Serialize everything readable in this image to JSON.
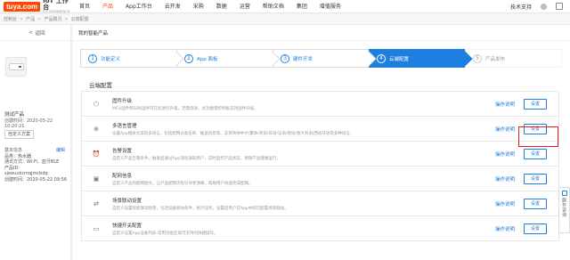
{
  "header": {
    "logo_badge": "tuya.com",
    "logo_title": "IoT 工作台",
    "logo_sub": "IOT WORKBENCH",
    "nav": [
      "首页",
      "产品",
      "App工作台",
      "云开发",
      "采购",
      "数据",
      "运营",
      "帮助文档",
      "集团",
      "增值服务"
    ],
    "active_nav": "产品",
    "support": "技术支持",
    "accent": "#ff4800"
  },
  "breadcrumb": [
    "控制台",
    "产品",
    "产品概况",
    "云端配置"
  ],
  "sidebar": {
    "back": "返回",
    "product_name": "测试产品",
    "created": "创建时间：2020-05-22 10:20:21",
    "custom_button": "自定义方案",
    "info_title": "基本信息",
    "edit": "编辑",
    "info": [
      "品类：热水器",
      "通讯方式：Wi-Fi、蓝牙BLE",
      "产品ID:",
      "sjeeuukcmqjmcbdq",
      "创建时间：2020-05-22 09:56"
    ]
  },
  "main": {
    "title": "我的智能产品",
    "steps": [
      {
        "num": "1",
        "label": "功能定义"
      },
      {
        "num": "2",
        "label": "App 面板"
      },
      {
        "num": "3",
        "label": "硬件开发"
      },
      {
        "num": "4",
        "label": "云端配置"
      },
      {
        "num": "5",
        "label": "产品发布"
      }
    ],
    "active_step": 3,
    "section_title": "云端配置",
    "rows": [
      {
        "icon": "firmware-icon",
        "glyph": "⬡",
        "title": "固件升级",
        "desc": "MCU固件和SDK固件可在此进行升级，无需烧录。此功能需控制板支持固件升级。",
        "doc": "操作说明",
        "btn": "设置"
      },
      {
        "icon": "language-icon",
        "glyph": "⊕",
        "title": "多语言管理",
        "desc": "设置App相关文案的多语言，包括配网分类名称、推送消息等。支持简体中文/繁体/英语/日语/法语/德语/意大利语/西班牙语等多种语言。",
        "doc": "操作说明",
        "btn": "设置"
      },
      {
        "icon": "alarm-icon",
        "glyph": "⏰",
        "title": "告警设置",
        "desc": "自定义产品告警条件，触发后通过App消息通知用户，实时监控产品状态，保障产品健康运行。",
        "doc": "操作说明",
        "btn": "设置"
      },
      {
        "icon": "network-config-icon",
        "glyph": "▣",
        "title": "配网信息",
        "desc": "自定义产品的配网图文，让产品配网流程引导更清晰，帮助用户快速完成配网。",
        "doc": "操作说明",
        "btn": "设置"
      },
      {
        "icon": "scene-icon",
        "glyph": "⇄",
        "title": "场景联动设置",
        "desc": "自定义设置智能联动场景，包括设备联动条件，执行任务，设置后用户在App中即可配置场景联动。",
        "doc": "操作说明",
        "btn": "设置"
      },
      {
        "icon": "shortcut-icon",
        "glyph": "▭",
        "title": "快捷开关配置",
        "desc": "自定义设置App设备列表-常用功能区域可支持的快捷操作。",
        "doc": "操作说明",
        "btn": "设置"
      }
    ]
  },
  "float_tab": "服务咨询",
  "colors": {
    "primary": "#1e7fe0",
    "highlight": "#e02020"
  }
}
